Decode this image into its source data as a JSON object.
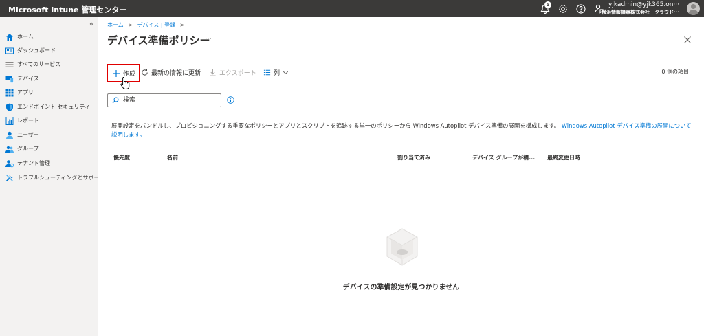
{
  "app": {
    "title": "Microsoft Intune 管理センター"
  },
  "topbar": {
    "notification_count": "5",
    "account_email": "yjkadmin@yjk365.on···",
    "account_org": "横浜情報機器株式会社　クラウド···"
  },
  "sidebar": {
    "collapse_glyph": "«",
    "items": [
      {
        "label": "ホーム",
        "icon": "home-icon"
      },
      {
        "label": "ダッシュボード",
        "icon": "dashboard-icon"
      },
      {
        "label": "すべてのサービス",
        "icon": "all-services-icon"
      },
      {
        "label": "デバイス",
        "icon": "devices-icon"
      },
      {
        "label": "アプリ",
        "icon": "apps-icon"
      },
      {
        "label": "エンドポイント セキュリティ",
        "icon": "endpoint-security-icon"
      },
      {
        "label": "レポート",
        "icon": "reports-icon"
      },
      {
        "label": "ユーザー",
        "icon": "user-icon"
      },
      {
        "label": "グループ",
        "icon": "groups-icon"
      },
      {
        "label": "テナント管理",
        "icon": "tenant-admin-icon"
      },
      {
        "label": "トラブルシューティングとサポート",
        "icon": "troubleshooting-icon"
      }
    ]
  },
  "breadcrumb": {
    "items": [
      "ホーム",
      "デバイス | 登録"
    ],
    "separator": ">"
  },
  "page": {
    "title": "デバイス準備ポリシー",
    "more_glyph": "···"
  },
  "toolbar": {
    "create_label": "作成",
    "refresh_label": "最新の情報に更新",
    "export_label": "エクスポート",
    "columns_label": "列",
    "item_count": "0 個の項目"
  },
  "search": {
    "placeholder": "検索"
  },
  "description": {
    "text": "展開設定をバンドルし、プロビジョニングする重要なポリシーとアプリとスクリプトを追跡する単一のポリシーから Windows Autopilot デバイス準備の展開を構成します。",
    "link": "Windows Autopilot デバイス準備の展開について説明します。"
  },
  "table": {
    "columns": [
      "優先度",
      "名前",
      "割り当て済み",
      "デバイス グループが構...",
      "最終変更日時"
    ]
  },
  "empty_state": {
    "message": "デバイスの準備設定が見つかりません"
  },
  "colors": {
    "topbar": "#3b3a39",
    "accent": "#0078d4",
    "highlight": "#e00000"
  }
}
